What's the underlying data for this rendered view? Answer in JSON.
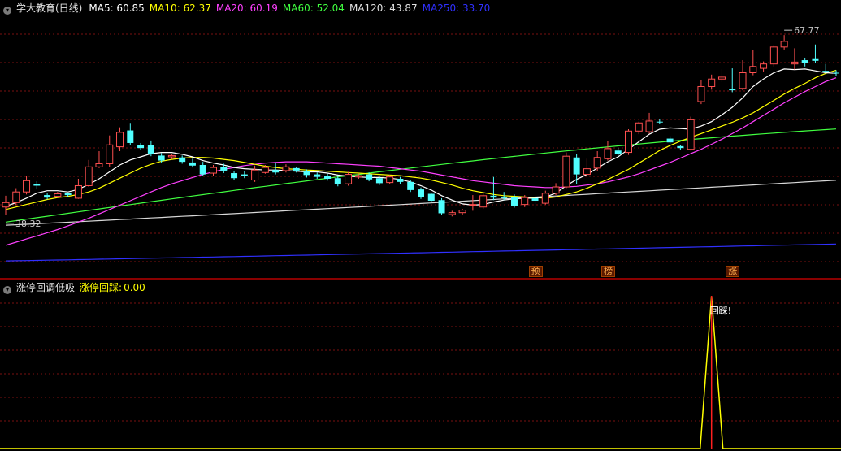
{
  "main_header": {
    "title": "学大教育(日线)",
    "indicators": [
      {
        "label": "MA5: 60.85",
        "color": "#ffffff"
      },
      {
        "label": "MA10: 62.37",
        "color": "#ffff00"
      },
      {
        "label": "MA20: 60.19",
        "color": "#ff40ff"
      },
      {
        "label": "MA60: 52.04",
        "color": "#40ff40"
      },
      {
        "label": "MA120: 43.87",
        "color": "#e0e0e0"
      },
      {
        "label": "MA250: 33.70",
        "color": "#3030ff"
      }
    ]
  },
  "sub_header": {
    "title": "涨停回调低吸",
    "indicator_name": "涨停回踩",
    "indicator_value": "0.00"
  },
  "colors": {
    "up": "#ff5050",
    "down": "#50ffff",
    "grid": "#7a1010",
    "ma5": "#ffffff",
    "ma10": "#ffff00",
    "ma20": "#ff40ff",
    "ma60": "#40ff40",
    "ma120": "#d8d8d8",
    "ma250": "#3030ff",
    "signal_line": "#ffff00",
    "signal_spike": "#ff2020"
  },
  "chart_data": [
    {
      "type": "candlestick",
      "ylim": [
        30.5,
        70.0
      ],
      "high_label": "67.77",
      "low_label": "38.32",
      "candles": [
        [
          39.6,
          40.3,
          38.3,
          41.4
        ],
        [
          40.3,
          42.0,
          39.9,
          42.6
        ],
        [
          42.0,
          43.8,
          41.6,
          44.5
        ],
        [
          43.2,
          43.0,
          42.4,
          43.7
        ],
        [
          41.5,
          41.1,
          40.8,
          41.8
        ],
        [
          41.3,
          41.7,
          41.1,
          42.0
        ],
        [
          41.8,
          41.5,
          41.2,
          41.9
        ],
        [
          41.0,
          43.0,
          40.9,
          44.1
        ],
        [
          43.0,
          46.0,
          42.8,
          47.1
        ],
        [
          46.0,
          46.5,
          45.8,
          48.5
        ],
        [
          46.5,
          49.5,
          46.0,
          51.0
        ],
        [
          49.2,
          51.5,
          48.5,
          52.3
        ],
        [
          51.8,
          49.8,
          49.5,
          53.0
        ],
        [
          49.5,
          49.0,
          48.7,
          49.8
        ],
        [
          49.5,
          48.0,
          47.7,
          50.2
        ],
        [
          47.8,
          47.0,
          46.7,
          48.2
        ],
        [
          47.6,
          47.8,
          47.2,
          48.0
        ],
        [
          47.5,
          46.8,
          46.5,
          47.8
        ],
        [
          46.7,
          46.2,
          45.9,
          47.3
        ],
        [
          46.3,
          44.8,
          44.5,
          46.8
        ],
        [
          45.0,
          45.9,
          44.6,
          46.3
        ],
        [
          46.0,
          45.4,
          45.0,
          46.5
        ],
        [
          45.0,
          44.2,
          43.9,
          45.3
        ],
        [
          44.8,
          44.5,
          44.2,
          45.3
        ],
        [
          43.9,
          45.5,
          43.6,
          46.2
        ],
        [
          45.1,
          45.9,
          44.9,
          46.3
        ],
        [
          45.5,
          45.1,
          44.8,
          46.7
        ],
        [
          45.4,
          46.0,
          45.1,
          46.4
        ],
        [
          45.8,
          45.4,
          45.1,
          46.0
        ],
        [
          45.3,
          44.7,
          44.3,
          45.6
        ],
        [
          44.8,
          44.4,
          44.1,
          45.1
        ],
        [
          44.6,
          44.1,
          43.8,
          44.9
        ],
        [
          44.2,
          43.2,
          42.9,
          44.5
        ],
        [
          43.3,
          44.8,
          43.0,
          45.2
        ],
        [
          44.4,
          44.6,
          44.1,
          44.9
        ],
        [
          44.8,
          44.0,
          43.7,
          45.1
        ],
        [
          44.2,
          43.4,
          43.1,
          44.5
        ],
        [
          43.5,
          44.4,
          43.2,
          44.7
        ],
        [
          44.1,
          43.6,
          43.3,
          44.4
        ],
        [
          43.6,
          42.3,
          42.0,
          43.9
        ],
        [
          42.4,
          41.2,
          40.9,
          42.7
        ],
        [
          41.7,
          40.6,
          40.3,
          41.9
        ],
        [
          40.7,
          38.6,
          38.3,
          41.0
        ],
        [
          38.4,
          38.7,
          38.1,
          39.0
        ],
        [
          38.7,
          39.1,
          38.4,
          39.3
        ],
        [
          40.0,
          40.0,
          39.0,
          41.5
        ],
        [
          39.6,
          41.4,
          39.3,
          42.0
        ],
        [
          41.4,
          41.1,
          40.7,
          44.4
        ],
        [
          41.2,
          41.0,
          40.7,
          42.0
        ],
        [
          41.2,
          39.8,
          39.5,
          41.6
        ],
        [
          40.0,
          41.1,
          39.6,
          41.5
        ],
        [
          41.0,
          40.6,
          39.0,
          41.3
        ],
        [
          40.2,
          41.8,
          40.0,
          42.2
        ],
        [
          41.8,
          42.8,
          41.5,
          43.4
        ],
        [
          42.8,
          47.7,
          42.6,
          48.3
        ],
        [
          47.5,
          44.8,
          43.3,
          48.0
        ],
        [
          44.8,
          45.7,
          44.5,
          47.3
        ],
        [
          45.8,
          47.5,
          45.4,
          48.5
        ],
        [
          47.3,
          48.9,
          47.0,
          50.1
        ],
        [
          48.6,
          48.1,
          47.8,
          49.0
        ],
        [
          48.3,
          51.7,
          47.9,
          52.0
        ],
        [
          51.7,
          53.0,
          51.2,
          53.2
        ],
        [
          51.6,
          53.3,
          51.3,
          54.6
        ],
        [
          53.2,
          53.1,
          52.8,
          53.6
        ],
        [
          50.5,
          49.9,
          49.6,
          50.9
        ],
        [
          49.3,
          49.0,
          48.7,
          49.5
        ],
        [
          48.8,
          53.5,
          48.6,
          54.0
        ],
        [
          56.4,
          58.8,
          56.0,
          59.9
        ],
        [
          58.8,
          60.0,
          58.3,
          60.7
        ],
        [
          60.0,
          60.3,
          59.5,
          61.6
        ],
        [
          58.4,
          58.2,
          57.9,
          61.7
        ],
        [
          58.5,
          61.0,
          58.2,
          63.0
        ],
        [
          61.0,
          62.0,
          60.6,
          64.6
        ],
        [
          61.7,
          62.4,
          61.2,
          62.8
        ],
        [
          62.4,
          65.1,
          62.0,
          65.4
        ],
        [
          65.1,
          66.0,
          64.7,
          67.0
        ],
        [
          62.4,
          62.7,
          61.5,
          64.9
        ],
        [
          63.0,
          62.6,
          62.0,
          63.4
        ],
        [
          63.3,
          62.9,
          62.6,
          65.5
        ],
        [
          61.3,
          61.1,
          60.8,
          62.4
        ],
        [
          61.0,
          60.9,
          60.5,
          61.4
        ]
      ],
      "ma5": [
        39.7,
        40.3,
        41.0,
        41.8,
        42.2,
        42.2,
        42.0,
        42.4,
        43.2,
        44.1,
        45.2,
        46.3,
        47.1,
        47.6,
        48.1,
        48.3,
        48.3,
        48.0,
        47.6,
        47.0,
        46.6,
        46.3,
        45.9,
        45.7,
        45.6,
        45.5,
        45.5,
        45.4,
        45.3,
        45.2,
        45.2,
        45.0,
        44.7,
        44.5,
        44.4,
        44.3,
        44.3,
        44.2,
        44.0,
        43.6,
        43.0,
        42.3,
        41.4,
        40.7,
        40.1,
        39.9,
        40.0,
        40.4,
        40.7,
        40.9,
        41.0,
        41.0,
        41.2,
        41.8,
        43.0,
        44.0,
        44.8,
        45.8,
        46.8,
        47.6,
        48.8,
        50.0,
        51.2,
        52.0,
        52.2,
        52.1,
        52.0,
        52.5,
        53.2,
        54.3,
        55.5,
        57.0,
        58.8,
        60.0,
        61.0,
        61.6,
        61.5,
        61.6,
        61.3,
        61.0,
        60.9
      ],
      "ma10": [
        39.2,
        39.6,
        40.0,
        40.4,
        40.8,
        41.1,
        41.3,
        41.6,
        42.0,
        42.6,
        43.4,
        44.2,
        45.0,
        45.8,
        46.4,
        46.9,
        47.2,
        47.4,
        47.5,
        47.5,
        47.4,
        47.2,
        47.0,
        46.7,
        46.4,
        46.1,
        45.9,
        45.7,
        45.6,
        45.5,
        45.4,
        45.3,
        45.2,
        45.1,
        45.0,
        44.9,
        44.8,
        44.7,
        44.6,
        44.4,
        44.2,
        43.9,
        43.5,
        43.1,
        42.6,
        42.2,
        41.9,
        41.6,
        41.4,
        41.3,
        41.2,
        41.1,
        41.0,
        41.2,
        41.6,
        42.0,
        42.6,
        43.3,
        44.0,
        44.8,
        45.6,
        46.6,
        47.6,
        48.6,
        49.4,
        50.1,
        50.7,
        51.3,
        51.9,
        52.5,
        53.1,
        53.8,
        54.6,
        55.6,
        56.6,
        57.6,
        58.5,
        59.3,
        60.2,
        60.9,
        61.4
      ],
      "ma20": [
        33.5,
        34.0,
        34.5,
        35.0,
        35.5,
        36.0,
        36.6,
        37.2,
        37.8,
        38.5,
        39.2,
        39.9,
        40.6,
        41.3,
        42.0,
        42.7,
        43.3,
        43.8,
        44.3,
        44.8,
        45.2,
        45.6,
        45.9,
        46.2,
        46.4,
        46.6,
        46.7,
        46.8,
        46.8,
        46.8,
        46.7,
        46.6,
        46.5,
        46.4,
        46.3,
        46.2,
        46.1,
        45.9,
        45.7,
        45.5,
        45.3,
        45.0,
        44.7,
        44.4,
        44.1,
        43.8,
        43.6,
        43.4,
        43.2,
        43.0,
        42.9,
        42.8,
        42.7,
        42.7,
        42.8,
        42.9,
        43.1,
        43.3,
        43.6,
        44.0,
        44.4,
        44.9,
        45.5,
        46.1,
        46.7,
        47.4,
        48.1,
        48.8,
        49.6,
        50.4,
        51.3,
        52.2,
        53.2,
        54.2,
        55.2,
        56.2,
        57.1,
        58.0,
        58.8,
        59.6,
        60.2
      ],
      "ma60": [
        33.5
      ],
      "ma120": [
        33.5
      ],
      "ma250": [
        33.5
      ]
    },
    {
      "type": "line",
      "series_name": "涨停回踩",
      "ylim": [
        0,
        1
      ],
      "spike_index": 68,
      "spike_value": 1.0,
      "annotation": "回踩!"
    }
  ],
  "signal_tags": [
    {
      "index": 51,
      "label": "预"
    },
    {
      "index": 58,
      "label": "榜"
    },
    {
      "index": 70,
      "label": "涨"
    }
  ]
}
